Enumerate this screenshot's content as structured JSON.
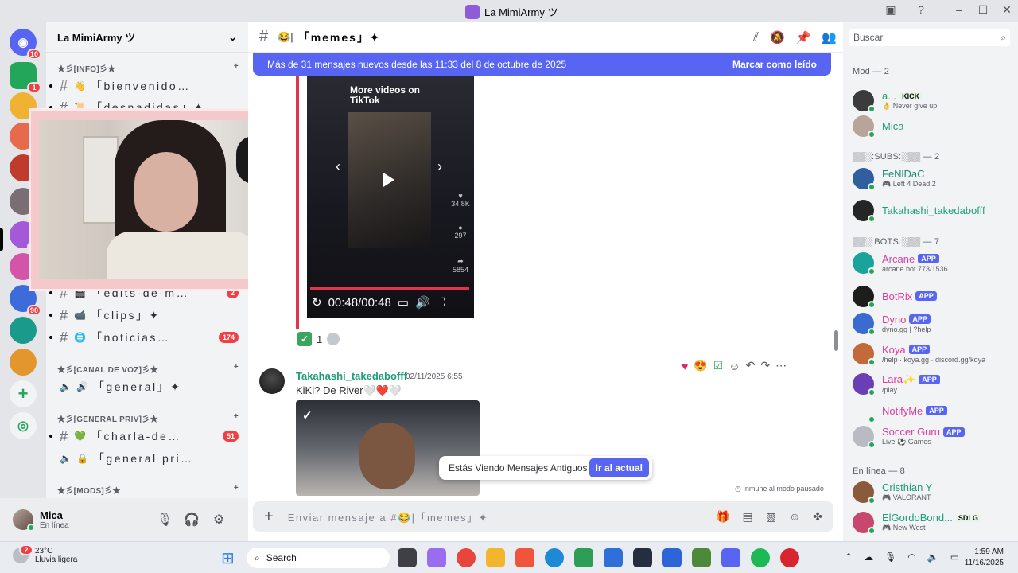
{
  "window": {
    "title": "La MimiArmy ツ"
  },
  "servers": {
    "dm_badge": "10",
    "items": [
      {
        "badge": "1",
        "color": "#23a55a"
      },
      {
        "badge": "",
        "color": "#f0b232"
      },
      {
        "badge": "",
        "color": "#e66a4c"
      },
      {
        "badge": "",
        "color": "#c03b2b"
      },
      {
        "badge": "",
        "color": "#7a6d73"
      },
      {
        "badge": "24",
        "color": "#a45ad8"
      },
      {
        "badge": "",
        "color": "#d455a8"
      },
      {
        "badge": "90",
        "color": "#3d6bd9"
      },
      {
        "badge": "",
        "color": "#1a9a8a"
      },
      {
        "badge": "",
        "color": "#e3962e"
      }
    ]
  },
  "sidebar": {
    "server_name": "La MimiArmy ツ",
    "cat_info": "★彡[INFO]彡★",
    "ch_bienvenido": "「bienvenido…",
    "ch_desnadidas": "「desnadidas」✦",
    "ch_edits": "「edits-de-m…",
    "ch_edits_badge": "2",
    "ch_clips": "「clips」✦",
    "ch_noticias": "「noticias…",
    "ch_noticias_badge": "174",
    "cat_voz": "★彡[CANAL DE VOZ]彡★",
    "ch_general": "「general」✦",
    "cat_priv": "★彡[GENERAL PRIV]彡★",
    "ch_charla": "「charla-de…",
    "ch_charla_badge": "51",
    "ch_generalpriv": "「general pri…",
    "cat_mods": "★彡[MODS]彡★"
  },
  "user": {
    "name": "Mica",
    "status": "En línea"
  },
  "channel": {
    "name": "「memes」✦"
  },
  "banner": {
    "text": "Más de 31 mensajes nuevos desde las 11:33 del 8 de octubre de 2025",
    "action": "Marcar como leído"
  },
  "tiktok": {
    "title": "More videos on TikTok",
    "likes": "34.8K",
    "comments": "297",
    "shares": "5854",
    "time": "00:48/00:48"
  },
  "reaction": {
    "count": "1"
  },
  "message2": {
    "author": "Takahashi_takedabofff",
    "time": "02/11/2025 6:55",
    "text": "KiKi? De River🤍❤️🤍"
  },
  "old_notice": {
    "text": "Estás Viendo Mensajes Antiguos",
    "action": "Ir al actual"
  },
  "slowmode": "Inmune al modo pausado",
  "composer": {
    "placeholder": "Enviar mensaje a #😂|「memes」✦"
  },
  "members": {
    "search_placeholder": "Buscar",
    "group_mod": "Mod — 2",
    "group_subs": "▒▒░:SUBS:░▒▒ — 2",
    "group_bots": "▒▒░:BOTS:░▒▒ — 7",
    "group_online": "En línea — 8",
    "list": [
      {
        "name": "a...",
        "sub": "👌 Never give up",
        "tag": "KICK",
        "color": "#1e9e5a",
        "av": "#3b3b3b"
      },
      {
        "name": "Mica",
        "sub": "",
        "tag": "",
        "color": "#1f9e78",
        "av": "#b9a49a"
      },
      {
        "name": "FeNlDaC",
        "sub": "🎮 Left 4 Dead 2",
        "tag": "",
        "color": "#1f8a70",
        "av": "#2f5f9f"
      },
      {
        "name": "Takahashi_takedabofff",
        "sub": "",
        "tag": "",
        "color": "#1f9e78",
        "av": "#252525"
      },
      {
        "name": "Arcane",
        "sub": "arcane.bot 773/1536",
        "tag": "APP",
        "color": "#d6409f",
        "av": "#19a39b"
      },
      {
        "name": "BotRix",
        "sub": "",
        "tag": "APP",
        "color": "#d6409f",
        "av": "#1d1d1d"
      },
      {
        "name": "Dyno",
        "sub": "dyno.gg | ?help",
        "tag": "APP",
        "color": "#d6409f",
        "av": "#3a6bd1"
      },
      {
        "name": "Koya",
        "sub": "/help · koya.gg · discord.gg/koya",
        "tag": "APP",
        "color": "#d6409f",
        "av": "#c46a3a"
      },
      {
        "name": "Lara✨",
        "sub": "/play",
        "tag": "APP",
        "color": "#d6409f",
        "av": "#6a3fb5"
      },
      {
        "name": "NotifyMe",
        "sub": "",
        "tag": "APP",
        "color": "#d6409f",
        "av": "#f2f3f5"
      },
      {
        "name": "Soccer Guru",
        "sub": "Live ⚽ Games",
        "tag": "APP",
        "color": "#d6409f",
        "av": "#b8bcc2"
      },
      {
        "name": "Cristhian Y",
        "sub": "🎮 VALORANT",
        "tag": "",
        "color": "#1f9e78",
        "av": "#8a5a3a"
      },
      {
        "name": "ElGordoBond...",
        "sub": "🎮 New West",
        "tag": "SDLG",
        "color": "#1f9e78",
        "av": "#c9476e"
      }
    ]
  },
  "taskbar": {
    "weather_temp": "23°C",
    "weather_desc": "Lluvia ligera",
    "weather_badge": "2",
    "search": "Search",
    "time": "1:59 AM",
    "date": "11/16/2025"
  }
}
